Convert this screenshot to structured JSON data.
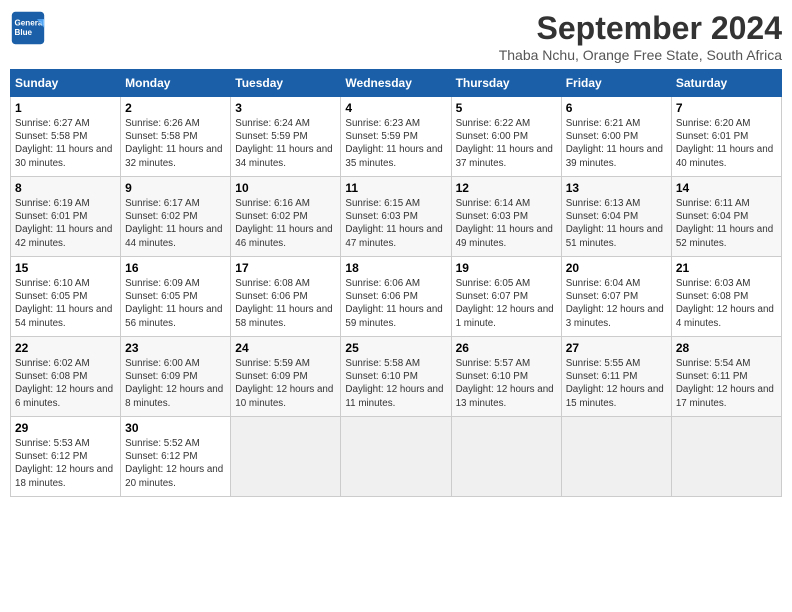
{
  "header": {
    "logo_line1": "General",
    "logo_line2": "Blue",
    "month": "September 2024",
    "location": "Thaba Nchu, Orange Free State, South Africa"
  },
  "weekdays": [
    "Sunday",
    "Monday",
    "Tuesday",
    "Wednesday",
    "Thursday",
    "Friday",
    "Saturday"
  ],
  "weeks": [
    [
      {
        "day": "1",
        "sunrise": "6:27 AM",
        "sunset": "5:58 PM",
        "daylight": "11 hours and 30 minutes."
      },
      {
        "day": "2",
        "sunrise": "6:26 AM",
        "sunset": "5:58 PM",
        "daylight": "11 hours and 32 minutes."
      },
      {
        "day": "3",
        "sunrise": "6:24 AM",
        "sunset": "5:59 PM",
        "daylight": "11 hours and 34 minutes."
      },
      {
        "day": "4",
        "sunrise": "6:23 AM",
        "sunset": "5:59 PM",
        "daylight": "11 hours and 35 minutes."
      },
      {
        "day": "5",
        "sunrise": "6:22 AM",
        "sunset": "6:00 PM",
        "daylight": "11 hours and 37 minutes."
      },
      {
        "day": "6",
        "sunrise": "6:21 AM",
        "sunset": "6:00 PM",
        "daylight": "11 hours and 39 minutes."
      },
      {
        "day": "7",
        "sunrise": "6:20 AM",
        "sunset": "6:01 PM",
        "daylight": "11 hours and 40 minutes."
      }
    ],
    [
      {
        "day": "8",
        "sunrise": "6:19 AM",
        "sunset": "6:01 PM",
        "daylight": "11 hours and 42 minutes."
      },
      {
        "day": "9",
        "sunrise": "6:17 AM",
        "sunset": "6:02 PM",
        "daylight": "11 hours and 44 minutes."
      },
      {
        "day": "10",
        "sunrise": "6:16 AM",
        "sunset": "6:02 PM",
        "daylight": "11 hours and 46 minutes."
      },
      {
        "day": "11",
        "sunrise": "6:15 AM",
        "sunset": "6:03 PM",
        "daylight": "11 hours and 47 minutes."
      },
      {
        "day": "12",
        "sunrise": "6:14 AM",
        "sunset": "6:03 PM",
        "daylight": "11 hours and 49 minutes."
      },
      {
        "day": "13",
        "sunrise": "6:13 AM",
        "sunset": "6:04 PM",
        "daylight": "11 hours and 51 minutes."
      },
      {
        "day": "14",
        "sunrise": "6:11 AM",
        "sunset": "6:04 PM",
        "daylight": "11 hours and 52 minutes."
      }
    ],
    [
      {
        "day": "15",
        "sunrise": "6:10 AM",
        "sunset": "6:05 PM",
        "daylight": "11 hours and 54 minutes."
      },
      {
        "day": "16",
        "sunrise": "6:09 AM",
        "sunset": "6:05 PM",
        "daylight": "11 hours and 56 minutes."
      },
      {
        "day": "17",
        "sunrise": "6:08 AM",
        "sunset": "6:06 PM",
        "daylight": "11 hours and 58 minutes."
      },
      {
        "day": "18",
        "sunrise": "6:06 AM",
        "sunset": "6:06 PM",
        "daylight": "11 hours and 59 minutes."
      },
      {
        "day": "19",
        "sunrise": "6:05 AM",
        "sunset": "6:07 PM",
        "daylight": "12 hours and 1 minute."
      },
      {
        "day": "20",
        "sunrise": "6:04 AM",
        "sunset": "6:07 PM",
        "daylight": "12 hours and 3 minutes."
      },
      {
        "day": "21",
        "sunrise": "6:03 AM",
        "sunset": "6:08 PM",
        "daylight": "12 hours and 4 minutes."
      }
    ],
    [
      {
        "day": "22",
        "sunrise": "6:02 AM",
        "sunset": "6:08 PM",
        "daylight": "12 hours and 6 minutes."
      },
      {
        "day": "23",
        "sunrise": "6:00 AM",
        "sunset": "6:09 PM",
        "daylight": "12 hours and 8 minutes."
      },
      {
        "day": "24",
        "sunrise": "5:59 AM",
        "sunset": "6:09 PM",
        "daylight": "12 hours and 10 minutes."
      },
      {
        "day": "25",
        "sunrise": "5:58 AM",
        "sunset": "6:10 PM",
        "daylight": "12 hours and 11 minutes."
      },
      {
        "day": "26",
        "sunrise": "5:57 AM",
        "sunset": "6:10 PM",
        "daylight": "12 hours and 13 minutes."
      },
      {
        "day": "27",
        "sunrise": "5:55 AM",
        "sunset": "6:11 PM",
        "daylight": "12 hours and 15 minutes."
      },
      {
        "day": "28",
        "sunrise": "5:54 AM",
        "sunset": "6:11 PM",
        "daylight": "12 hours and 17 minutes."
      }
    ],
    [
      {
        "day": "29",
        "sunrise": "5:53 AM",
        "sunset": "6:12 PM",
        "daylight": "12 hours and 18 minutes."
      },
      {
        "day": "30",
        "sunrise": "5:52 AM",
        "sunset": "6:12 PM",
        "daylight": "12 hours and 20 minutes."
      },
      null,
      null,
      null,
      null,
      null
    ]
  ]
}
